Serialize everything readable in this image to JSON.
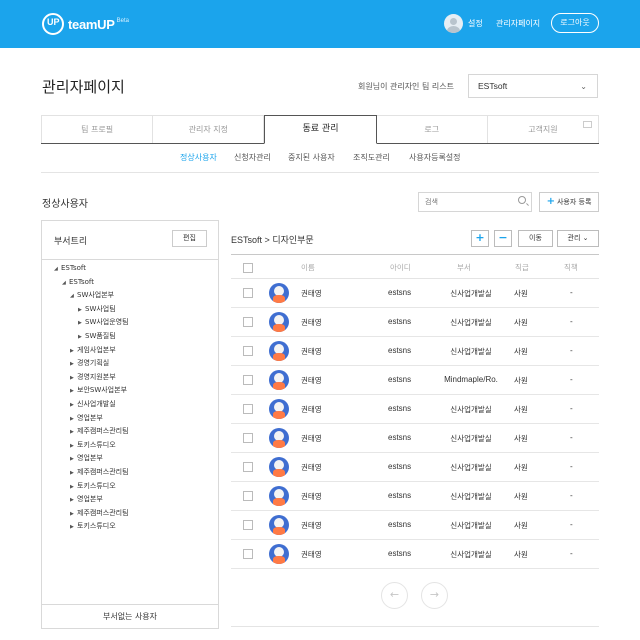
{
  "header": {
    "logo_text": "teamUP",
    "logo_badge": "Beta",
    "logo_mark": "UP",
    "settings_label": "설정",
    "admin_label": "관리자페이지",
    "logout_label": "로그아웃"
  },
  "page": {
    "title": "관리자페이지",
    "team_caption": "회원님이 관리자인 팀 리스트",
    "team_selected": "ESTsoft"
  },
  "tabs": [
    "팀 프로필",
    "관리자 지정",
    "동료 관리",
    "로그",
    "고객지원"
  ],
  "active_tab": "동료 관리",
  "subnav": [
    "정상사용자",
    "신청자관리",
    "중지된 사용자",
    "조직도관리",
    "사용자등록설정"
  ],
  "active_subnav": "정상사용자",
  "section": {
    "title": "정상사용자",
    "search_placeholder": "검색",
    "add_user_label": "사용자 등록"
  },
  "dept_panel": {
    "title": "부서트리",
    "edit_label": "편집",
    "no_dept_label": "부서없는 사용자",
    "tree": [
      {
        "label": "ESTsoft",
        "level": 0,
        "expanded": true
      },
      {
        "label": "ESTsoft",
        "level": 1,
        "expanded": true
      },
      {
        "label": "SW사업본부",
        "level": 2,
        "expanded": true
      },
      {
        "label": "SW사업팀",
        "level": 3,
        "expanded": false
      },
      {
        "label": "SW사업운영팀",
        "level": 3,
        "expanded": false
      },
      {
        "label": "SW품질팀",
        "level": 3,
        "expanded": false
      },
      {
        "label": "게임사업본부",
        "level": 2,
        "expanded": false
      },
      {
        "label": "경영기획실",
        "level": 2,
        "expanded": false
      },
      {
        "label": "경영지원본부",
        "level": 2,
        "expanded": false
      },
      {
        "label": "보안SW사업본부",
        "level": 2,
        "expanded": false
      },
      {
        "label": "신사업개발실",
        "level": 2,
        "expanded": false
      },
      {
        "label": "영업본부",
        "level": 2,
        "expanded": false
      },
      {
        "label": "제주캠퍼스관리팀",
        "level": 2,
        "expanded": false
      },
      {
        "label": "토키스튜디오",
        "level": 2,
        "expanded": false
      },
      {
        "label": "영업본부",
        "level": 2,
        "expanded": false
      },
      {
        "label": "제주캠퍼스관리팀",
        "level": 2,
        "expanded": false
      },
      {
        "label": "토키스튜디오",
        "level": 2,
        "expanded": false
      },
      {
        "label": "영업본부",
        "level": 2,
        "expanded": false
      },
      {
        "label": "제주캠퍼스관리팀",
        "level": 2,
        "expanded": false
      },
      {
        "label": "토키스튜디오",
        "level": 2,
        "expanded": false
      }
    ]
  },
  "list": {
    "breadcrumb_root": "ESTsoft",
    "breadcrumb_sep": ">",
    "breadcrumb_current": "디자인부문",
    "plus_label": "+",
    "minus_label": "−",
    "move_label": "이동",
    "manage_label": "관리",
    "columns": [
      "이름",
      "아이디",
      "부서",
      "직급",
      "직책"
    ],
    "rows": [
      {
        "name": "권태영",
        "id": "estsns",
        "dept": "신사업개발실",
        "rank": "사원",
        "position": "-"
      },
      {
        "name": "권태영",
        "id": "estsns",
        "dept": "신사업개발실",
        "rank": "사원",
        "position": "-"
      },
      {
        "name": "권태영",
        "id": "estsns",
        "dept": "신사업개발실",
        "rank": "사원",
        "position": "-"
      },
      {
        "name": "권태영",
        "id": "estsns",
        "dept": "Mindmaple/Ro.",
        "rank": "사원",
        "position": "-"
      },
      {
        "name": "권태영",
        "id": "estsns",
        "dept": "신사업개발실",
        "rank": "사원",
        "position": "-"
      },
      {
        "name": "권태영",
        "id": "estsns",
        "dept": "신사업개발실",
        "rank": "사원",
        "position": "-"
      },
      {
        "name": "권태영",
        "id": "estsns",
        "dept": "신사업개발실",
        "rank": "사원",
        "position": "-"
      },
      {
        "name": "권태영",
        "id": "estsns",
        "dept": "신사업개발실",
        "rank": "사원",
        "position": "-"
      },
      {
        "name": "권태영",
        "id": "estsns",
        "dept": "신사업개발실",
        "rank": "사원",
        "position": "-"
      },
      {
        "name": "권태영",
        "id": "estsns",
        "dept": "신사업개발실",
        "rank": "사원",
        "position": "-"
      }
    ],
    "prev_icon": "←",
    "next_icon": "→"
  },
  "colors": {
    "brand": "#1ba4ec",
    "avatar_bg": "#3f6ed1"
  }
}
